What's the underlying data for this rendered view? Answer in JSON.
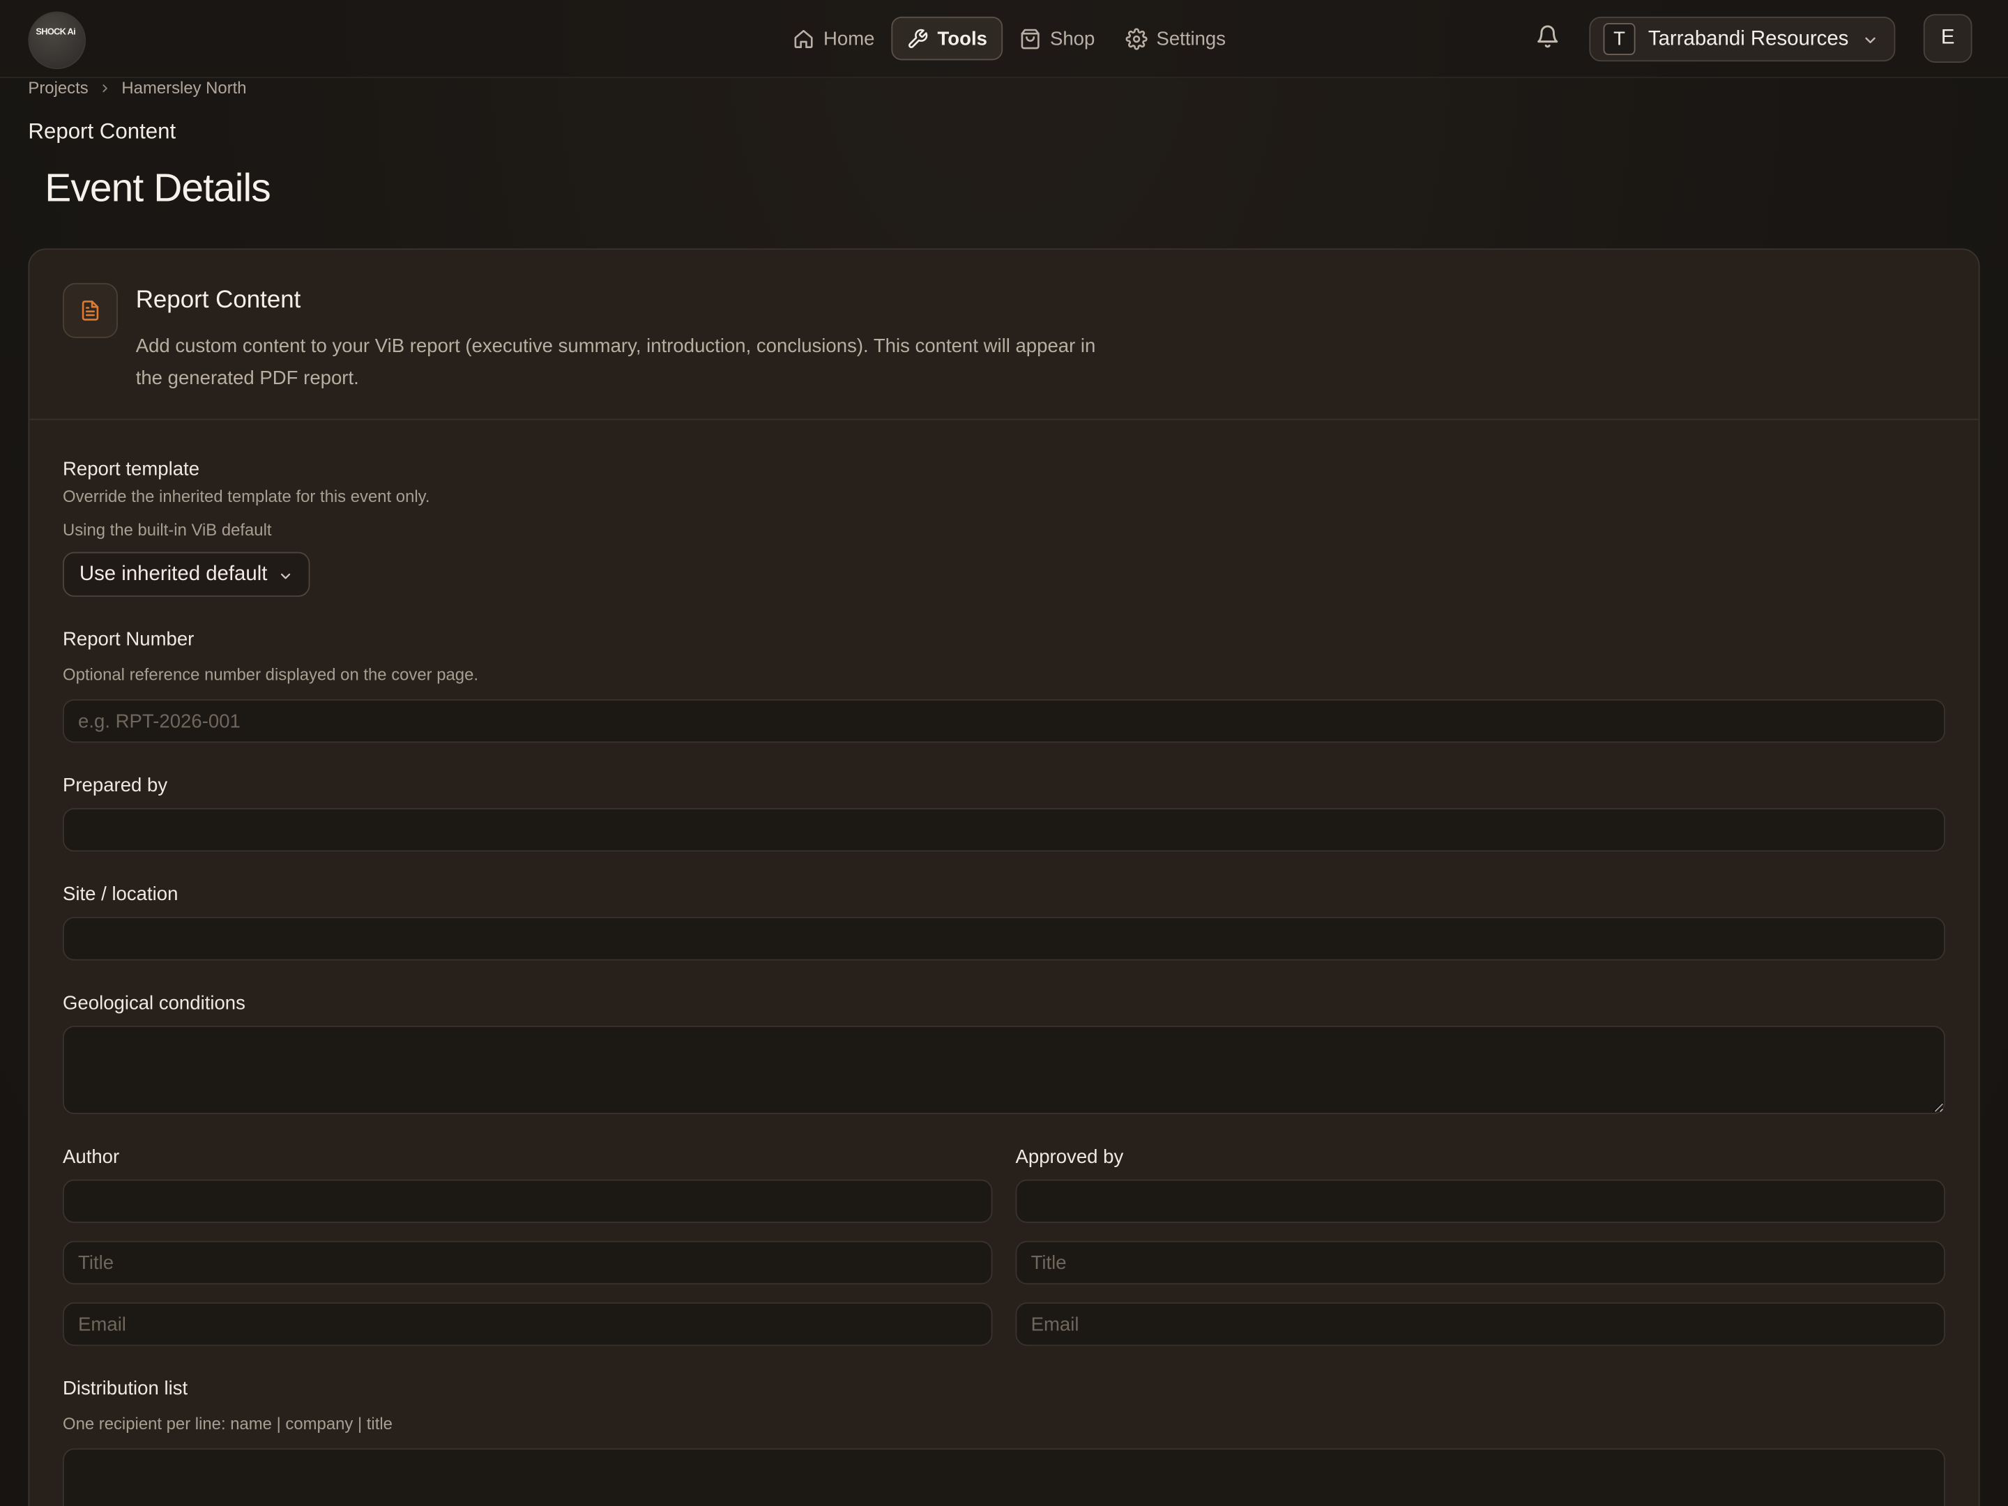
{
  "nav": {
    "logo_text": "SHOCK Ai",
    "items": [
      {
        "label": "Home",
        "icon": "home-icon"
      },
      {
        "label": "Tools",
        "icon": "wrench-icon",
        "active": true
      },
      {
        "label": "Shop",
        "icon": "shopping-bag-icon"
      },
      {
        "label": "Settings",
        "icon": "gear-icon"
      }
    ],
    "org_initial": "T",
    "org_name": "Tarrabandi Resources",
    "user_initial": "E"
  },
  "breadcrumb": [
    "Projects",
    "Hamersley North"
  ],
  "page": {
    "section_label": "Report Content",
    "title": "Event Details"
  },
  "card": {
    "title": "Report Content",
    "description": "Add custom content to your ViB report (executive summary, introduction, conclusions). This content will appear in the generated PDF report.",
    "template": {
      "label": "Report template",
      "hint": "Override the inherited template for this event only.",
      "status": "Using the built-in ViB default",
      "selected": "Use inherited default"
    },
    "report_number": {
      "label": "Report Number",
      "hint": "Optional reference number displayed on the cover page.",
      "placeholder": "e.g. RPT-2026-001",
      "value": ""
    },
    "prepared_by": {
      "label": "Prepared by",
      "value": ""
    },
    "site_location": {
      "label": "Site / location",
      "value": ""
    },
    "geological_conditions": {
      "label": "Geological conditions",
      "value": ""
    },
    "author": {
      "label": "Author",
      "name_value": "",
      "title_placeholder": "Title",
      "email_placeholder": "Email"
    },
    "approved_by": {
      "label": "Approved by",
      "name_value": "",
      "title_placeholder": "Title",
      "email_placeholder": "Email"
    },
    "distribution": {
      "label": "Distribution list",
      "hint": "One recipient per line: name | company | title",
      "value": ""
    }
  },
  "colors": {
    "background": "#1a1714",
    "card": "#28211b",
    "input": "#1c1814",
    "accent": "#e07a2e"
  }
}
